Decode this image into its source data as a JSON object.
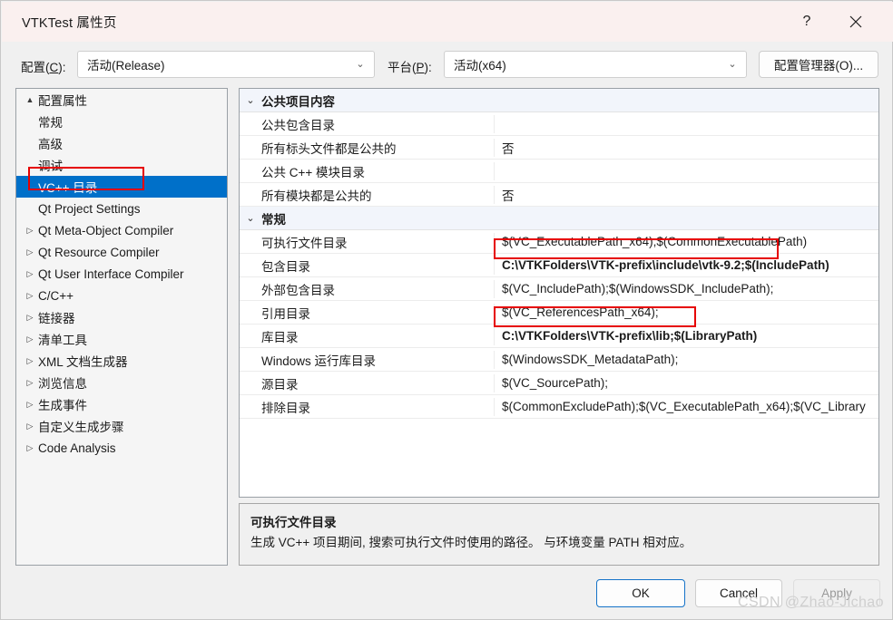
{
  "window": {
    "title": "VTKTest 属性页",
    "help_icon": "help-question-icon",
    "close_icon": "close-x-icon"
  },
  "config_bar": {
    "config_label_pre": "配置(",
    "config_label_key": "C",
    "config_label_post": "):",
    "config_value": "活动(Release)",
    "platform_label_pre": "平台(",
    "platform_label_key": "P",
    "platform_label_post": "):",
    "platform_value": "活动(x64)",
    "config_manager_label": "配置管理器(O)...",
    "chevron": "⌄"
  },
  "tree": {
    "items": [
      {
        "label": "配置属性",
        "level": 0,
        "twisty": "▲",
        "selected": false
      },
      {
        "label": "常规",
        "level": 1,
        "twisty": "",
        "selected": false
      },
      {
        "label": "高级",
        "level": 1,
        "twisty": "",
        "selected": false
      },
      {
        "label": "调试",
        "level": 1,
        "twisty": "",
        "selected": false
      },
      {
        "label": "VC++ 目录",
        "level": 1,
        "twisty": "",
        "selected": true
      },
      {
        "label": "Qt Project Settings",
        "level": 1,
        "twisty": "",
        "selected": false
      },
      {
        "label": "Qt Meta-Object Compiler",
        "level": 1,
        "twisty": "▷",
        "selected": false
      },
      {
        "label": "Qt Resource Compiler",
        "level": 1,
        "twisty": "▷",
        "selected": false
      },
      {
        "label": "Qt User Interface Compiler",
        "level": 1,
        "twisty": "▷",
        "selected": false
      },
      {
        "label": "C/C++",
        "level": 1,
        "twisty": "▷",
        "selected": false
      },
      {
        "label": "链接器",
        "level": 1,
        "twisty": "▷",
        "selected": false
      },
      {
        "label": "清单工具",
        "level": 1,
        "twisty": "▷",
        "selected": false
      },
      {
        "label": "XML 文档生成器",
        "level": 1,
        "twisty": "▷",
        "selected": false
      },
      {
        "label": "浏览信息",
        "level": 1,
        "twisty": "▷",
        "selected": false
      },
      {
        "label": "生成事件",
        "level": 1,
        "twisty": "▷",
        "selected": false
      },
      {
        "label": "自定义生成步骤",
        "level": 1,
        "twisty": "▷",
        "selected": false
      },
      {
        "label": "Code Analysis",
        "level": 1,
        "twisty": "▷",
        "selected": false
      }
    ]
  },
  "grid": {
    "groups": [
      {
        "title": "公共项目内容",
        "twisty": "⌄",
        "rows": [
          {
            "name": "公共包含目录",
            "value": "",
            "highlight": false
          },
          {
            "name": "所有标头文件都是公共的",
            "value": "否",
            "highlight": false
          },
          {
            "name": "公共 C++ 模块目录",
            "value": "",
            "highlight": false
          },
          {
            "name": "所有模块都是公共的",
            "value": "否",
            "highlight": false
          }
        ]
      },
      {
        "title": "常规",
        "twisty": "⌄",
        "rows": [
          {
            "name": "可执行文件目录",
            "value": "$(VC_ExecutablePath_x64);$(CommonExecutablePath)",
            "highlight": false
          },
          {
            "name": "包含目录",
            "value": "C:\\VTKFolders\\VTK-prefix\\include\\vtk-9.2;$(IncludePath)",
            "highlight": true
          },
          {
            "name": "外部包含目录",
            "value": "$(VC_IncludePath);$(WindowsSDK_IncludePath);",
            "highlight": false
          },
          {
            "name": "引用目录",
            "value": "$(VC_ReferencesPath_x64);",
            "highlight": false
          },
          {
            "name": "库目录",
            "value": "C:\\VTKFolders\\VTK-prefix\\lib;$(LibraryPath)",
            "highlight": true
          },
          {
            "name": "Windows 运行库目录",
            "value": "$(WindowsSDK_MetadataPath);",
            "highlight": false
          },
          {
            "name": "源目录",
            "value": "$(VC_SourcePath);",
            "highlight": false
          },
          {
            "name": "排除目录",
            "value": "$(CommonExcludePath);$(VC_ExecutablePath_x64);$(VC_Library",
            "highlight": false
          }
        ]
      }
    ]
  },
  "description": {
    "title": "可执行文件目录",
    "body": "生成 VC++ 项目期间, 搜索可执行文件时使用的路径。 与环境变量 PATH 相对应。"
  },
  "footer": {
    "ok_label": "OK",
    "cancel_label": "Cancel",
    "apply_label": "Apply"
  },
  "watermark": "CSDN @Zhao-Jichao",
  "colors": {
    "selection_blue": "#0070c9",
    "annotation_red": "#e60000",
    "titlebar": "#faf0ef",
    "accent_border": "#1573c8"
  }
}
